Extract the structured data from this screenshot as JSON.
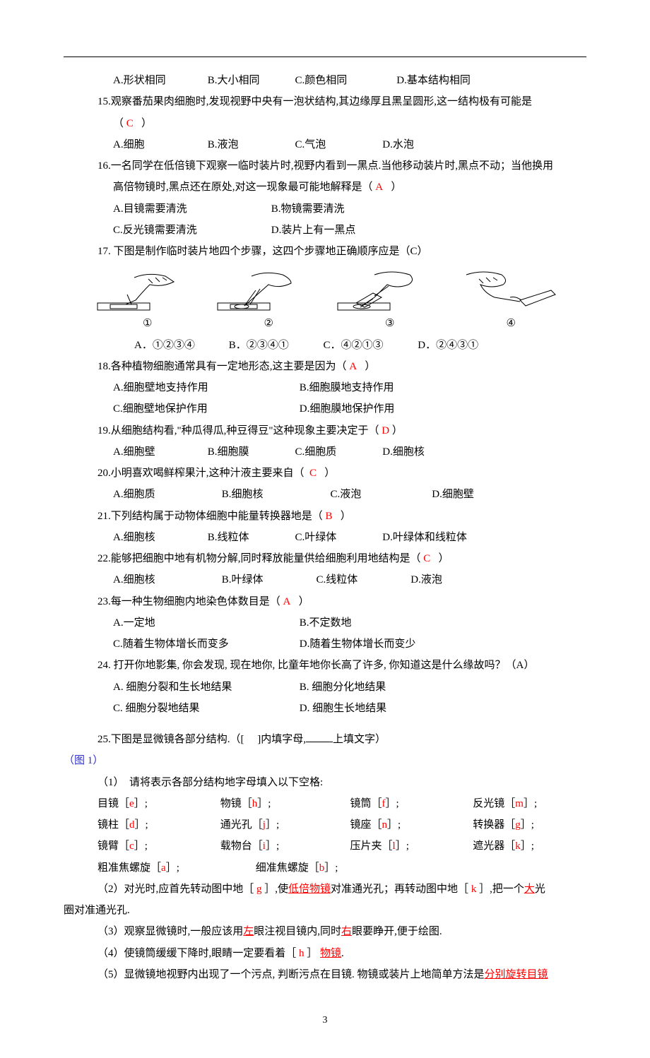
{
  "q14": {
    "A": "A.形状相同",
    "B": "B.大小相同",
    "C": "C.颜色相同",
    "D": "D.基本结构相同"
  },
  "q15": {
    "stem": "15.观察番茄果肉细胞时,发现视野中央有一泡状结构,其边缘厚且黑呈圆形,这一结构极有可能是",
    "ansOpen": "（",
    "ans": "C",
    "ansClose": "）",
    "A": "A.细胞",
    "B": "B.液泡",
    "C": "C.气泡",
    "D": "D.水泡"
  },
  "q16": {
    "stem1": "16.一名同学在低倍镜下观察一临时装片时,视野内看到一黑点.当他移动装片时,黑点不动；当他换用",
    "stem2_a": "高倍物镜时,黑点还在原处,对这一现象最可能地解释是（",
    "ans": "A",
    "stem2_b": "）",
    "A": "A.目镜需要清洗",
    "B": "B.物镜需要清洗",
    "C": "C.反光镜需要清洗",
    "D": "D.装片上有一黑点"
  },
  "q17": {
    "stem": "17. 下图是制作临时装片地四个步骤，这四个步骤地正确顺序应是（C）",
    "n1": "①",
    "n2": "②",
    "n3": "③",
    "n4": "④",
    "A": "A．①②③④",
    "B": "B．②③④①",
    "C": "C．④②①③",
    "D": "D．②④③①"
  },
  "q18": {
    "stem_a": "18.各种植物细胞通常具有一定地形态,这主要是因为（",
    "ans": "A",
    "stem_b": "）",
    "A": "A.细胞壁地支持作用",
    "B": "B.细胞膜地支持作用",
    "C": "C.细胞壁地保护作用",
    "D": "D.细胞膜地保护作用"
  },
  "q19": {
    "stem": "19.从细胞结构看,\"种瓜得瓜,种豆得豆\"这种现象主要决定于（",
    "ans": "D",
    "stem_b": "）",
    "A": "A.细胞壁",
    "B": "B.细胞膜",
    "C": "C.细胞质",
    "D": "D.细胞核"
  },
  "q20": {
    "stem": "20.小明喜欢喝鲜榨果汁,这种汁液主要来自（",
    "ans": "C",
    "stem_b": "）",
    "A": "A.细胞质",
    "B": "B.细胞核",
    "C": "C.液泡",
    "D": "D.细胞壁"
  },
  "q21": {
    "stem": "21.下列结构属于动物体细胞中能量转换器地是（",
    "ans": "B",
    "stem_b": "）",
    "A": "A.细胞核",
    "B": "B.线粒体",
    "C": "C.叶绿体",
    "D": "D.叶绿体和线粒体"
  },
  "q22": {
    "stem": "22.能够把细胞中地有机物分解,同时释放能量供给细胞利用地结构是（",
    "ans": "C",
    "stem_b": "）",
    "A": "A.细胞核",
    "B": "B.叶绿体",
    "C": "C.线粒体",
    "D": "D.液泡"
  },
  "q23": {
    "stem": "23.每一种生物细胞内地染色体数目是（",
    "ans": "A",
    "stem_b": "）",
    "A": "A.一定地",
    "B": "B.不定数地",
    "C": "C.随着生物体增长而变多",
    "D": "D.随着生物体增长而变少"
  },
  "q24": {
    "stem": "24. 打开你地影集, 你会发现, 现在地你, 比童年地你长高了许多, 你知道这是什么缘故吗？（A）",
    "A": "A. 细胞分裂和生长地结果",
    "B": "B. 细胞分化地结果",
    "C": "C. 细胞分裂地结果",
    "D": "D. 细胞生长地结果"
  },
  "q25": {
    "stem_a": "25.下图是显微镜各部分结构.（[　 ]内填字母,",
    "stem_b": "上填文字）",
    "figLabel": "（图 1）",
    "p1_lead": "（1）　请将表示各部分结构地字母填入以下空格:",
    "row1": {
      "l1": "目镜［",
      "a1": "e",
      "r1": "］;",
      "l2": "物镜［",
      "a2": "h",
      "r2": "］;",
      "l3": "镜筒［",
      "a3": "f",
      "r3": "］;",
      "l4": "反光镜［",
      "a4": "m",
      "r4": "］;"
    },
    "row2": {
      "l1": "镜柱［",
      "a1": "d",
      "r1": "］;",
      "l2": "通光孔［",
      "a2": "j",
      "r2": "］;",
      "l3": "镜座［",
      "a3": "n",
      "r3": "］;",
      "l4": "转换器［",
      "a4": "g",
      "r4": "］;"
    },
    "row3": {
      "l1": "镜臂［",
      "a1": "c",
      "r1": "］;",
      "l2": "载物台［",
      "a2": "i",
      "r2": "］;",
      "l3": "压片夹［",
      "a3": "l",
      "r3": "］;",
      "l4": "遮光器［",
      "a4": "k",
      "r4": "］;"
    },
    "row4": {
      "l1": "粗准焦螺旋［",
      "a1": "a",
      "r1": "］;",
      "l2": "细准焦螺旋［",
      "a2": "b",
      "r2": "］;"
    },
    "p2_a": "（2）对光时,应首先转动图中地［",
    "p2_ans1": "g",
    "p2_b": "］,使",
    "p2_ul1": "低倍物镜",
    "p2_c": "对准通光孔；再转动图中地［",
    "p2_ans2": "k",
    "p2_d": "］,把一个",
    "p2_ul2": "大",
    "p2_e": "光",
    "p2_line2": "圈对准通光孔.",
    "p3_a": "（3）观察显微镜时,一般应该用",
    "p3_ul1": "左",
    "p3_b": "眼注视目镜内,同时",
    "p3_ul2": "右",
    "p3_c": "眼要睁开,便于绘图.",
    "p4_a": "（4）使镜筒缓缓下降时,眼睛一定要看着［",
    "p4_ans": "h",
    "p4_b": "］",
    "p4_ul": "物镜",
    "p4_c": ".",
    "p5_a": "（5）显微镜地视野内出现了一个污点, 判断污点在目镜. 物镜或装片上地简单方法是",
    "p5_ul": "分别旋转目镜"
  },
  "pageNum": "3"
}
